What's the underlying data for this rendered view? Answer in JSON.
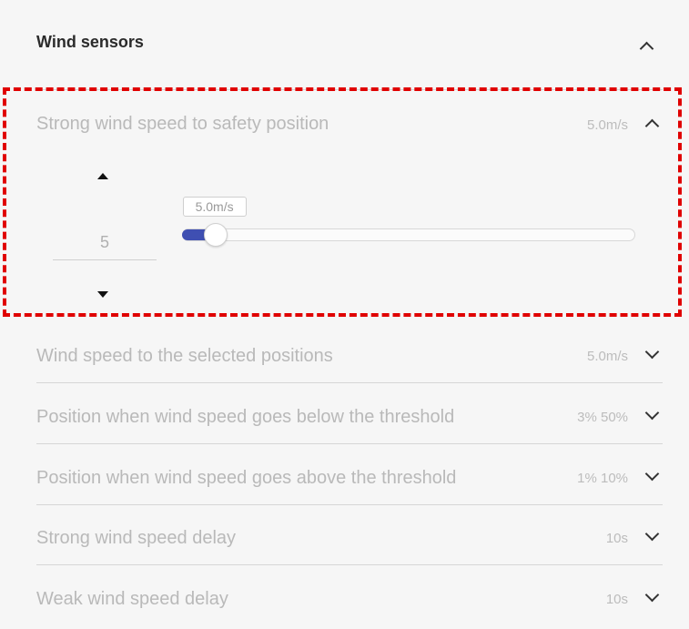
{
  "section": {
    "title": "Wind sensors"
  },
  "expanded": {
    "label": "Strong wind speed to safety position",
    "value": "5.0m/s",
    "stepper_value": "5",
    "slider": {
      "tooltip": "5.0m/s",
      "min": 0,
      "max": 100,
      "value": 5
    }
  },
  "rows": [
    {
      "label": "Wind speed to the selected positions",
      "value": "5.0m/s"
    },
    {
      "label": "Position when wind speed goes below the threshold",
      "value": "3% 50%"
    },
    {
      "label": "Position when wind speed goes above the threshold",
      "value": "1% 10%"
    },
    {
      "label": "Strong wind speed delay",
      "value": "10s"
    },
    {
      "label": "Weak wind speed delay",
      "value": "10s"
    }
  ],
  "colors": {
    "accent": "#3f4fb2",
    "highlight": "#e00000"
  }
}
